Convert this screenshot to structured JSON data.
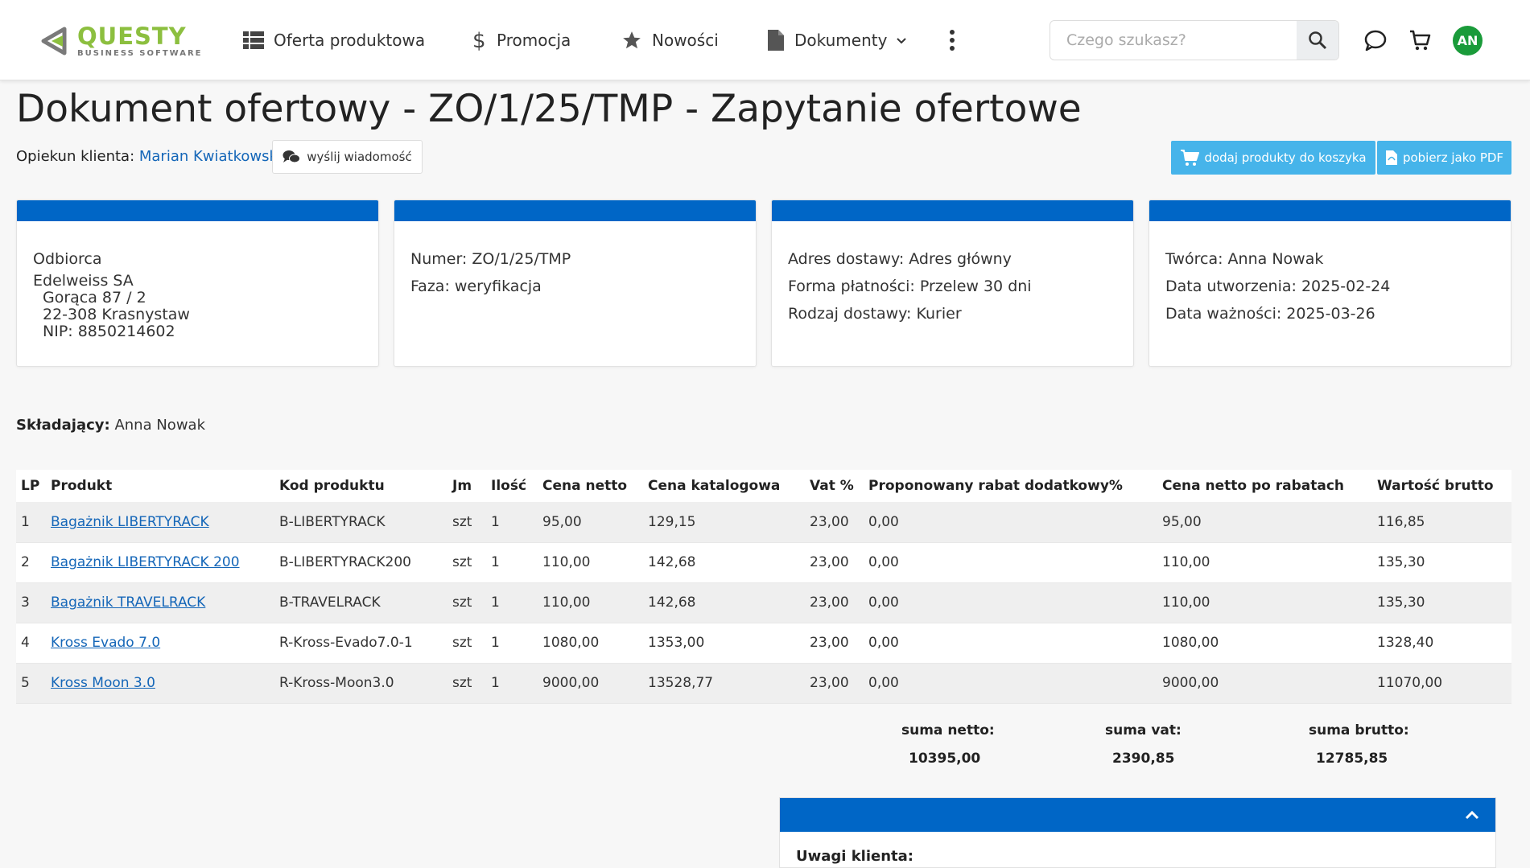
{
  "brand": {
    "name": "QUESTY",
    "tagline": "BUSINESS SOFTWARE",
    "color": "#8cbf3f"
  },
  "nav": {
    "oferta": "Oferta produktowa",
    "promocja": "Promocja",
    "nowosci": "Nowości",
    "dokumenty": "Dokumenty"
  },
  "search": {
    "placeholder": "Czego szukasz?",
    "value": ""
  },
  "user": {
    "initials": "AN",
    "avatar_color": "#1a9b3a"
  },
  "page": {
    "title": "Dokument ofertowy - ZO/1/25/TMP - Zapytanie ofertowe",
    "opiekun_label": "Opiekun klienta:",
    "opiekun_name": "Marian Kwiatkowski",
    "send_message": "wyślij wiadomość",
    "add_to_cart": "dodaj produkty do koszyka",
    "download_pdf": "pobierz jako PDF"
  },
  "cards": {
    "odbiorca": {
      "title": "Odbiorca",
      "company": "Edelweiss SA",
      "street": "Gorąca 87 / 2",
      "city": "22-308 Krasnystaw",
      "nip": "NIP: 8850214602"
    },
    "dokument": {
      "numer": "Numer: ZO/1/25/TMP",
      "faza": "Faza: weryfikacja"
    },
    "dostawa": {
      "adres": "Adres dostawy: Adres główny",
      "platnosc": "Forma płatności: Przelew 30 dni",
      "rodzaj": "Rodzaj dostawy: Kurier"
    },
    "meta": {
      "tworca": "Twórca: Anna Nowak",
      "utworzenia": "Data utworzenia: 2025-02-24",
      "waznosci": "Data ważności: 2025-03-26"
    }
  },
  "skladajacy": {
    "label": "Składający:",
    "value": "Anna Nowak"
  },
  "table": {
    "headers": [
      "LP",
      "Produkt",
      "Kod produktu",
      "Jm",
      "Ilość",
      "Cena netto",
      "Cena katalogowa",
      "Vat %",
      "Proponowany rabat dodatkowy%",
      "Cena netto po rabatach",
      "Wartość brutto"
    ],
    "rows": [
      {
        "lp": "1",
        "produkt": "Bagażnik LIBERTYRACK",
        "kod": "B-LIBERTYRACK",
        "jm": "szt",
        "ilosc": "1",
        "netto": "95,00",
        "katalog": "129,15",
        "vat": "23,00",
        "rabat": "0,00",
        "po_rabat": "95,00",
        "brutto": "116,85"
      },
      {
        "lp": "2",
        "produkt": "Bagażnik LIBERTYRACK 200",
        "kod": "B-LIBERTYRACK200",
        "jm": "szt",
        "ilosc": "1",
        "netto": "110,00",
        "katalog": "142,68",
        "vat": "23,00",
        "rabat": "0,00",
        "po_rabat": "110,00",
        "brutto": "135,30"
      },
      {
        "lp": "3",
        "produkt": "Bagażnik TRAVELRACK",
        "kod": "B-TRAVELRACK",
        "jm": "szt",
        "ilosc": "1",
        "netto": "110,00",
        "katalog": "142,68",
        "vat": "23,00",
        "rabat": "0,00",
        "po_rabat": "110,00",
        "brutto": "135,30"
      },
      {
        "lp": "4",
        "produkt": "Kross Evado 7.0",
        "kod": "R-Kross-Evado7.0-1",
        "jm": "szt",
        "ilosc": "1",
        "netto": "1080,00",
        "katalog": "1353,00",
        "vat": "23,00",
        "rabat": "0,00",
        "po_rabat": "1080,00",
        "brutto": "1328,40"
      },
      {
        "lp": "5",
        "produkt": "Kross Moon 3.0",
        "kod": "R-Kross-Moon3.0",
        "jm": "szt",
        "ilosc": "1",
        "netto": "9000,00",
        "katalog": "13528,77",
        "vat": "23,00",
        "rabat": "0,00",
        "po_rabat": "9000,00",
        "brutto": "11070,00"
      }
    ]
  },
  "totals": {
    "netto_label": "suma netto:",
    "netto": "10395,00",
    "vat_label": "suma vat:",
    "vat": "2390,85",
    "brutto_label": "suma brutto:",
    "brutto": "12785,85"
  },
  "notes": {
    "label": "Uwagi klienta:"
  },
  "colors": {
    "primary": "#0066c6",
    "action": "#46b4ea",
    "link": "#1466b8"
  }
}
